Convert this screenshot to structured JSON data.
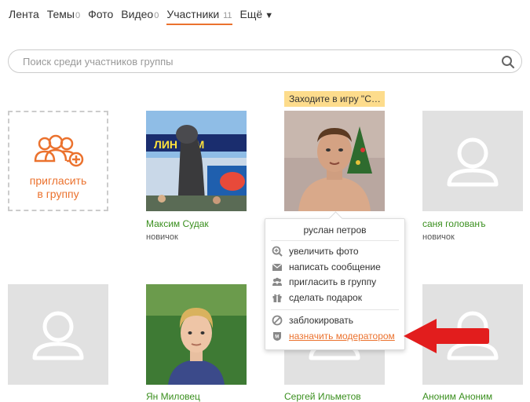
{
  "tabs": [
    {
      "label": "Лента",
      "count": ""
    },
    {
      "label": "Темы",
      "count": "0"
    },
    {
      "label": "Фото",
      "count": ""
    },
    {
      "label": "Видео",
      "count": "0"
    },
    {
      "label": "Участники",
      "count": "11"
    },
    {
      "label": "Ещё",
      "count": ""
    }
  ],
  "search": {
    "placeholder": "Поиск среди участников группы"
  },
  "invite": {
    "label_line1": "пригласить",
    "label_line2": "в группу"
  },
  "game_tooltip": "Заходите в игру \"С…",
  "members": [
    {
      "name": "Максим Судак",
      "status": "новичок"
    },
    {
      "name": "руслан петров",
      "status": ""
    },
    {
      "name": "саня голованъ",
      "status": "новичок"
    },
    {
      "name": "Ян Миловец",
      "status": ""
    },
    {
      "name": "Сергей Ильметов",
      "status": ""
    },
    {
      "name": "Аноним Аноним",
      "status": ""
    }
  ],
  "menu": {
    "title": "руслан петров",
    "items": [
      "увеличить фото",
      "написать сообщение",
      "пригласить в группу",
      "сделать подарок"
    ],
    "items2": [
      "заблокировать",
      "назначить модератором"
    ]
  },
  "colors": {
    "accent": "#eb722e",
    "name_green": "#3a8f1e",
    "arrow_red": "#e21d1d"
  }
}
